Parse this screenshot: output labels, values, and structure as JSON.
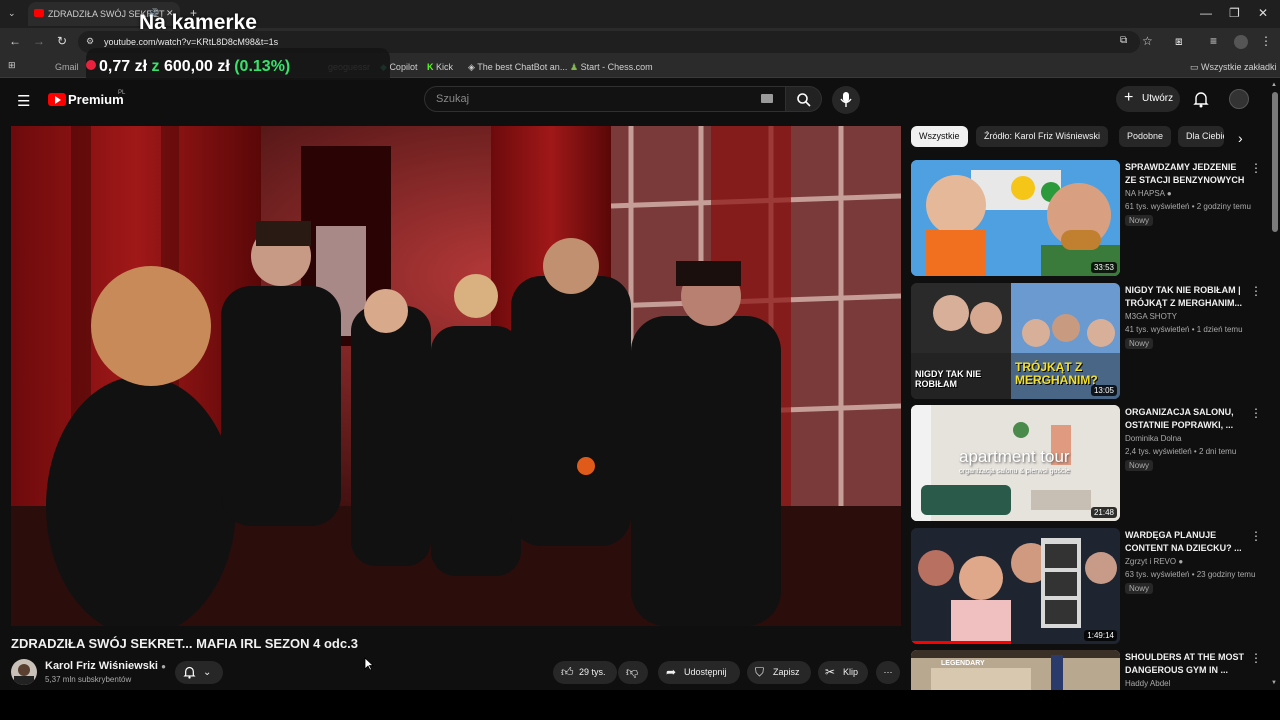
{
  "browser": {
    "tab_title": "ZDRADZIŁA SWÓJ SEKRET",
    "url": "youtube.com/watch?v=KRtL8D8cM98&t=1s",
    "bookmarks": [
      "Gmail",
      "geoguessr",
      "Copilot",
      "Kick",
      "The best ChatBot an...",
      "Start - Chess.com"
    ],
    "all_bookmarks": "Wszystkie zakładki"
  },
  "overlay": {
    "title": "Na kamerke",
    "amount_a": "0,77 zł",
    "z": "z",
    "amount_b": "600,00 zł",
    "percent": "(0.13%)",
    "progress": 0.0013
  },
  "youtube": {
    "logo": "Premium",
    "logo_sup": "PL",
    "search_placeholder": "Szukaj",
    "create_label": "Utwórz"
  },
  "chips": [
    "Wszystkie",
    "Źródło: Karol Friz Wiśniewski",
    "Podobne",
    "Dla Ciebie"
  ],
  "video": {
    "title": "ZDRADZIŁA SWÓJ SEKRET... MAFIA IRL SEZON 4 odc.3",
    "channel": "Karol Friz Wiśniewski",
    "subs": "5,37 mln subskrybentów",
    "likes": "29 tys.",
    "share": "Udostępnij",
    "save": "Zapisz",
    "clip": "Klip"
  },
  "recommendations": [
    {
      "title": "SPRAWDZAMY JEDZENIE ZE STACJI BENZYNOWYCH",
      "channel": "NA HAPSA",
      "meta": "61 tys. wyświetleń • 2 godziny temu",
      "badge": "Nowy",
      "duration": "33:53"
    },
    {
      "title": "NIGDY TAK NIE ROBIŁAM | TRÓJKĄT Z MERGHANIM...",
      "channel": "M3GA SHOTY",
      "meta": "41 tys. wyświetleń • 1 dzień temu",
      "badge": "Nowy",
      "duration": "13:05"
    },
    {
      "title": "ORGANIZACJA SALONU, OSTATNIE POPRAWKI, ...",
      "channel": "Dominika Dolna",
      "meta": "2,4 tys. wyświetleń • 2 dni temu",
      "badge": "Nowy",
      "duration": "21:48"
    },
    {
      "title": "WARDĘGA PLANUJE CONTENT NA DZIECKU? ...",
      "channel": "Zgrzyt i REVO",
      "meta": "63 tys. wyświetleń • 23 godziny temu",
      "badge": "Nowy",
      "duration": "1:49:14"
    },
    {
      "title": "SHOULDERS AT THE MOST DANGEROUS GYM IN ...",
      "channel": "Haddy Abdel",
      "meta": "",
      "badge": "",
      "duration": ""
    }
  ],
  "thumb_text": {
    "t2a": "NIGDY TAK NIE ROBIŁAM",
    "t2b": "TRÓJKĄT Z MERGHANIM?",
    "t3a": "apartment tour",
    "t3b": "organizacja salonu & pierwsi goście",
    "t5": "LEGENDARY"
  }
}
